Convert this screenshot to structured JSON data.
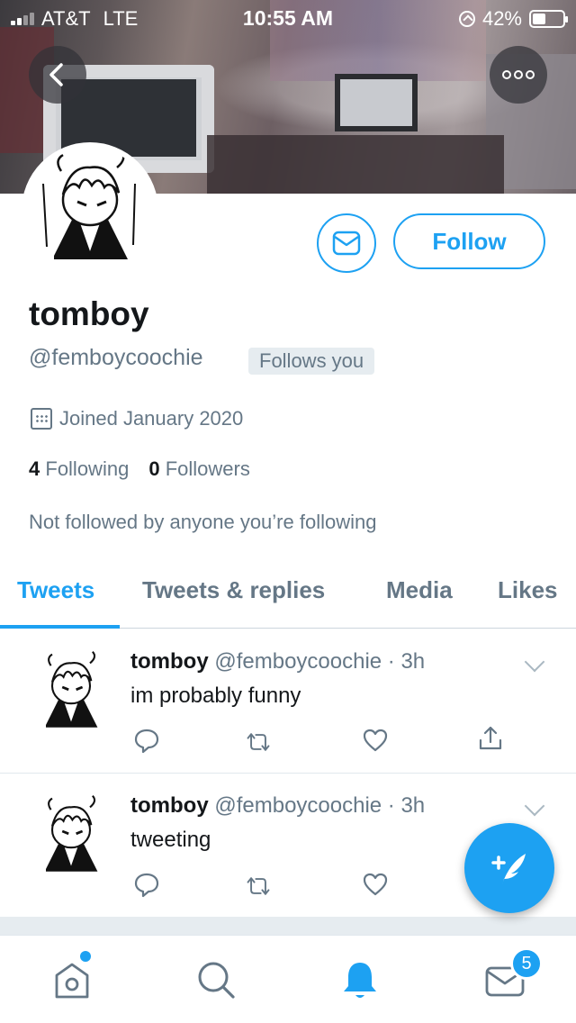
{
  "status_bar": {
    "carrier": "AT&T",
    "network": "LTE",
    "time": "10:55 AM",
    "battery": "42%"
  },
  "profile": {
    "display_name": "tomboy",
    "handle": "@femboycoochie",
    "follows_you": "Follows you",
    "joined": "Joined January 2020",
    "following_count": "4",
    "following_label": "Following",
    "followers_count": "0",
    "followers_label": "Followers",
    "not_followed": "Not followed by anyone you’re following",
    "follow_button": "Follow"
  },
  "tabs": [
    "Tweets",
    "Tweets & replies",
    "Media",
    "Likes"
  ],
  "tweets": [
    {
      "name": "tomboy",
      "meta": "@femboycoochie · 3h",
      "text": "im probably funny"
    },
    {
      "name": "tomboy",
      "meta": "@femboycoochie · 3h",
      "text": "tweeting"
    }
  ],
  "nav": {
    "messages_badge": "5"
  },
  "colors": {
    "accent": "#1da1f2",
    "secondary_text": "#657786",
    "primary_text": "#14171a"
  },
  "icons": [
    "back-arrow-icon",
    "more-icon",
    "mail-icon",
    "calendar-icon",
    "reply-icon",
    "retweet-icon",
    "like-icon",
    "share-icon",
    "chevron-down-icon",
    "compose-icon",
    "home-icon",
    "search-icon",
    "notifications-icon",
    "messages-icon"
  ]
}
